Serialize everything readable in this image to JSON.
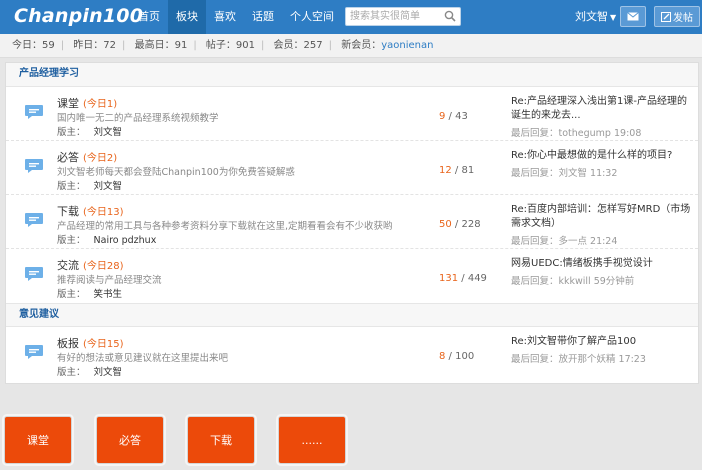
{
  "header": {
    "logo": "Chanpin100",
    "nav": [
      {
        "label": "首页",
        "active": false
      },
      {
        "label": "板块",
        "active": true
      },
      {
        "label": "喜欢",
        "active": false
      },
      {
        "label": "话题",
        "active": false
      },
      {
        "label": "个人空间",
        "active": false
      }
    ],
    "search_placeholder": "搜索其实很简单",
    "user": "刘文智",
    "post_label": "发帖"
  },
  "stats": {
    "today_label": "今日：",
    "today": "59",
    "yesterday_label": "昨日：",
    "yesterday": "72",
    "max_label": "最高日：",
    "max": "91",
    "posts_label": "帖子：",
    "posts": "901",
    "members_label": "会员：",
    "members": "257",
    "newest_label": "新会员：",
    "newest": "yaonienan"
  },
  "sections": [
    {
      "title": "产品经理学习",
      "forums": [
        {
          "name": "课堂",
          "today": "(今日1)",
          "desc": "国内唯一无二的产品经理系统视频教学",
          "mod_label": "版主：",
          "mod": "刘文智",
          "threads": "9",
          "posts": "43",
          "last_title": "Re:产品经理深入浅出第1课-产品经理的诞生的来龙去...",
          "last_meta": "最后回复：tothegump 19:08"
        },
        {
          "name": "必答",
          "today": "(今日2)",
          "desc": "刘文智老师每天都会登陆Chanpin100为你免费答疑解惑",
          "mod_label": "版主：",
          "mod": "刘文智",
          "threads": "12",
          "posts": "81",
          "last_title": "Re:你心中最想做的是什么样的项目?",
          "last_meta": "最后回复：刘文智 11:32"
        },
        {
          "name": "下载",
          "today": "(今日13)",
          "desc": "产品经理的常用工具与各种参考资料分享下载就在这里,定期看看会有不少收获哟",
          "mod_label": "版主：",
          "mod": "Nairo pdzhux",
          "threads": "50",
          "posts": "228",
          "last_title": "Re:百度内部培训：怎样写好MRD（市场需求文档）",
          "last_meta": "最后回复：多一点 21:24"
        },
        {
          "name": "交流",
          "today": "(今日28)",
          "desc": "推荐阅读与产品经理交流",
          "mod_label": "版主：",
          "mod": "笑书生",
          "threads": "131",
          "posts": "449",
          "last_title": "网易UEDC:情绪板携手视觉设计",
          "last_meta": "最后回复：kkkwill 59分钟前"
        }
      ]
    },
    {
      "title": "意见建议",
      "forums": [
        {
          "name": "板报",
          "today": "(今日15)",
          "desc": "有好的想法或意见建议就在这里提出来吧",
          "mod_label": "版主：",
          "mod": "刘文智",
          "threads": "8",
          "posts": "100",
          "last_title": "Re:刘文智带你了解产品100",
          "last_meta": "最后回复：放开那个妖精 17:23"
        }
      ]
    }
  ],
  "bottom_buttons": [
    "课堂",
    "必答",
    "下载",
    "......"
  ],
  "colors": {
    "header_bg": "#2e7dc4",
    "accent_orange": "#e8641b",
    "button_red": "#ec4a0a"
  }
}
